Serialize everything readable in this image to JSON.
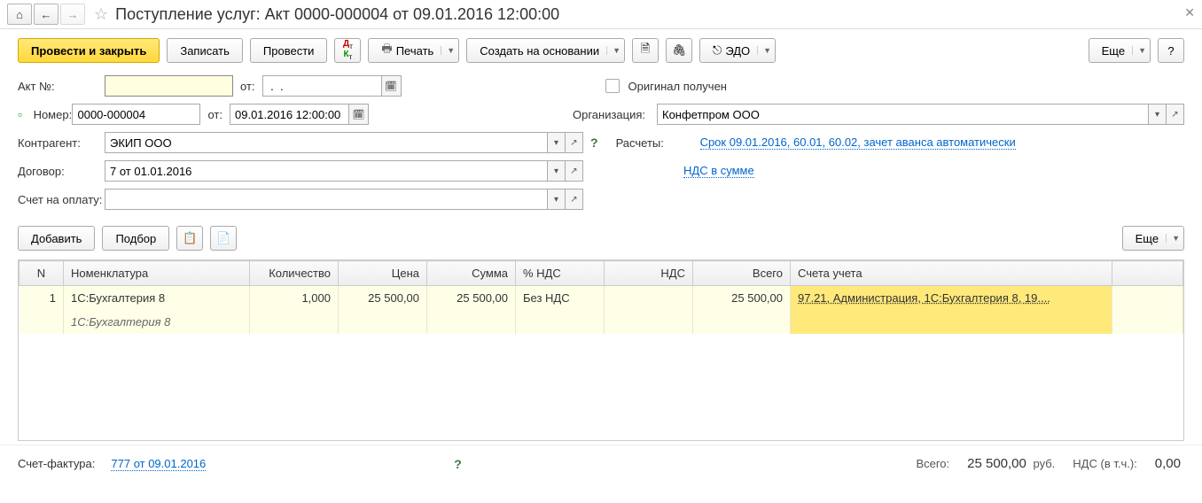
{
  "window": {
    "title": "Поступление услуг: Акт 0000-000004 от 09.01.2016 12:00:00"
  },
  "toolbar": {
    "post_close": "Провести и закрыть",
    "save": "Записать",
    "post": "Провести",
    "print": "Печать",
    "create_based": "Создать на основании",
    "edo": "ЭДО",
    "more": "Еще",
    "help": "?"
  },
  "form": {
    "act_label": "Акт №:",
    "act_value": "",
    "from": "от:",
    "act_date": " .  .    ",
    "number_label": "Номер:",
    "number_value": "0000-000004",
    "number_date": "09.01.2016 12:00:00",
    "counterparty_label": "Контрагент:",
    "counterparty_value": "ЭКИП ООО",
    "contract_label": "Договор:",
    "contract_value": "7 от 01.01.2016",
    "invoice_label": "Счет на оплату:",
    "invoice_value": "",
    "original_label": "Оригинал получен",
    "org_label": "Организация:",
    "org_value": "Конфетпром ООО",
    "calc_label": "Расчеты:",
    "calc_link": "Срок 09.01.2016, 60.01, 60.02, зачет аванса автоматически",
    "nds_link": "НДС в сумме"
  },
  "table_toolbar": {
    "add": "Добавить",
    "select": "Подбор",
    "more": "Еще"
  },
  "table": {
    "headers": {
      "n": "N",
      "item": "Номенклатура",
      "qty": "Количество",
      "price": "Цена",
      "sum": "Сумма",
      "vat_pct": "% НДС",
      "vat": "НДС",
      "total": "Всего",
      "accounts": "Счета учета"
    },
    "row": {
      "n": "1",
      "item": "1С:Бухгалтерия 8",
      "item_sub": "1С:Бухгалтерия 8",
      "qty": "1,000",
      "price": "25 500,00",
      "sum": "25 500,00",
      "vat_pct": "Без НДС",
      "vat": "",
      "total": "25 500,00",
      "accounts": "97.21, Администрация, 1С:Бухгалтерия 8, 19...."
    }
  },
  "footer": {
    "sf_label": "Счет-фактура:",
    "sf_link": "777 от 09.01.2016",
    "total_label": "Всего:",
    "total_value": "25 500,00",
    "currency": "руб.",
    "nds_label": "НДС (в т.ч.):",
    "nds_value": "0,00"
  }
}
